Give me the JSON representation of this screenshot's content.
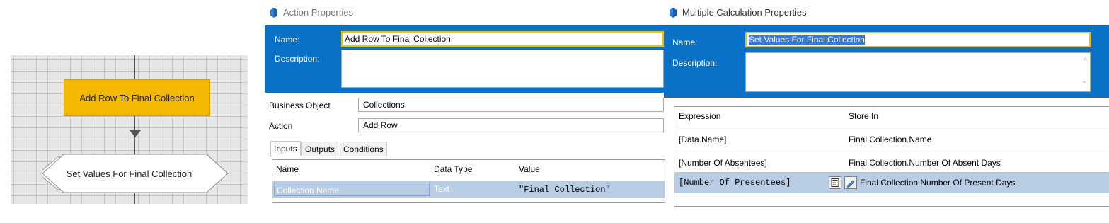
{
  "flow": {
    "action_stage_label": "Add Row To Final Collection",
    "calc_stage_label": "Set Values For Final Collection"
  },
  "action_window": {
    "title": "Action Properties",
    "name_label": "Name:",
    "name_value": "Add Row To Final Collection",
    "description_label": "Description:",
    "business_object_label": "Business Object",
    "business_object_value": "Collections",
    "action_label": "Action",
    "action_value": "Add Row",
    "tabs": [
      "Inputs",
      "Outputs",
      "Conditions"
    ],
    "grid_headers": [
      "Name",
      "Data Type",
      "Value"
    ],
    "grid_row": {
      "name": "Collection Name",
      "type": "Text",
      "value": "\"Final Collection\""
    }
  },
  "calc_window": {
    "title": "Multiple Calculation Properties",
    "name_label": "Name:",
    "name_value": "Set Values For Final Collection",
    "description_label": "Description:",
    "grid_headers": [
      "Expression",
      "Store In"
    ],
    "rows": [
      {
        "expression": "[Data.Name]",
        "store_in": "Final Collection.Name"
      },
      {
        "expression": "[Number Of Absentees]",
        "store_in": "Final Collection.Number Of Absent Days"
      },
      {
        "expression": "[Number Of Presentees]",
        "store_in": "Final Collection.Number Of Present Days"
      }
    ]
  },
  "colors": {
    "header_blue": "#0a72c6",
    "stage_yellow": "#f5b800",
    "selection": "#b8cce4",
    "focus_border": "#f2c200"
  },
  "icons": [
    "properties-icon",
    "calculator-icon",
    "edit-icon",
    "scroll-up-icon",
    "scroll-down-icon"
  ]
}
